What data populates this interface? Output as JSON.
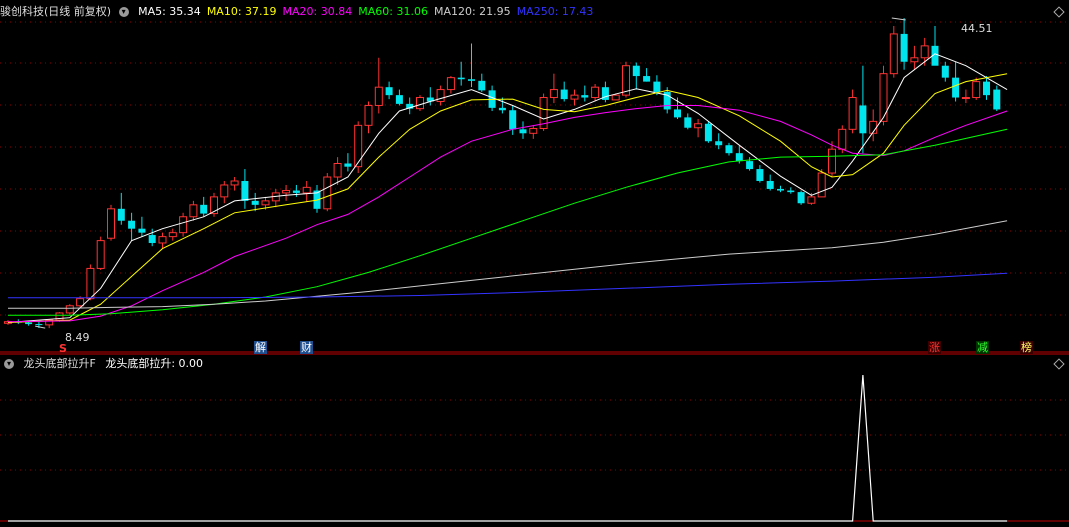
{
  "main_header": {
    "title": "骏创科技(日线 前复权)",
    "ma": [
      {
        "label": "MA5: 35.34",
        "color": "#ffffff"
      },
      {
        "label": "MA10: 37.19",
        "color": "#ffff00"
      },
      {
        "label": "MA20: 30.84",
        "color": "#ff00ff"
      },
      {
        "label": "MA60: 31.06",
        "color": "#00ff00"
      },
      {
        "label": "MA120: 21.95",
        "color": "#cccccc"
      },
      {
        "label": "MA250: 17.43",
        "color": "#3333ff"
      }
    ]
  },
  "sub_header": {
    "title": "龙头底部拉升F",
    "value_label": "龙头底部拉升: 0.00"
  },
  "price_labels": {
    "high": "44.51",
    "low": "8.49"
  },
  "event_tags": [
    {
      "text": "S",
      "color": "#ff3333",
      "bg": "transparent"
    },
    {
      "text": "解",
      "color": "#ffffff",
      "bg": "#1f4f8f"
    },
    {
      "text": "财",
      "color": "#ffffff",
      "bg": "#1f4f8f"
    },
    {
      "text": "涨",
      "color": "#ff3333",
      "bg": "#3a0000"
    },
    {
      "text": "减",
      "color": "#33ff33",
      "bg": "#003300"
    },
    {
      "text": "榜",
      "color": "#ffff66",
      "bg": "#3a0000"
    }
  ],
  "colors": {
    "up": "#ff3333",
    "down": "#00e5ee",
    "grid": "#8b0000",
    "axis": "#c00000"
  },
  "chart_data": {
    "type": "candlestick",
    "price_range": [
      7.5,
      47
    ],
    "ohlc": [
      [
        9.1,
        9.5,
        8.9,
        9.3
      ],
      [
        9.3,
        9.6,
        9.0,
        9.2
      ],
      [
        9.2,
        9.4,
        8.8,
        9.0
      ],
      [
        9.0,
        9.3,
        8.5,
        8.9
      ],
      [
        8.9,
        9.6,
        8.49,
        9.5
      ],
      [
        9.5,
        10.5,
        9.3,
        10.4
      ],
      [
        10.4,
        11.5,
        10.2,
        11.3
      ],
      [
        11.3,
        12.5,
        11.0,
        12.2
      ],
      [
        12.2,
        16.5,
        12.0,
        16.0
      ],
      [
        16.0,
        20.0,
        15.8,
        19.5
      ],
      [
        19.8,
        24.0,
        19.5,
        23.5
      ],
      [
        23.5,
        25.5,
        21.5,
        22.0
      ],
      [
        22.0,
        23.0,
        19.5,
        21.0
      ],
      [
        21.0,
        22.5,
        20.0,
        20.5
      ],
      [
        20.2,
        21.0,
        18.8,
        19.2
      ],
      [
        19.2,
        20.5,
        18.5,
        20.0
      ],
      [
        20.0,
        21.0,
        19.5,
        20.5
      ],
      [
        20.5,
        23.0,
        20.0,
        22.5
      ],
      [
        22.5,
        24.5,
        22.0,
        24.0
      ],
      [
        24.0,
        25.0,
        22.5,
        22.9
      ],
      [
        22.9,
        25.5,
        22.5,
        25.0
      ],
      [
        25.0,
        27.0,
        24.2,
        26.5
      ],
      [
        26.5,
        27.5,
        25.8,
        27.0
      ],
      [
        27.0,
        28.5,
        23.5,
        24.5
      ],
      [
        24.5,
        25.5,
        23.2,
        24.0
      ],
      [
        24.0,
        25.0,
        23.4,
        24.5
      ],
      [
        24.5,
        26.0,
        23.7,
        25.5
      ],
      [
        25.5,
        26.5,
        24.5,
        25.8
      ],
      [
        25.8,
        26.5,
        25.0,
        25.5
      ],
      [
        25.5,
        27.0,
        24.4,
        26.2
      ],
      [
        25.8,
        26.5,
        23.0,
        23.5
      ],
      [
        23.5,
        28.0,
        23.2,
        27.5
      ],
      [
        27.5,
        30.0,
        26.5,
        29.2
      ],
      [
        29.2,
        30.5,
        28.2,
        28.8
      ],
      [
        28.8,
        34.5,
        28.0,
        34.0
      ],
      [
        34.0,
        37.0,
        33.0,
        36.5
      ],
      [
        36.5,
        42.5,
        35.5,
        38.8
      ],
      [
        38.8,
        39.5,
        37.3,
        37.8
      ],
      [
        37.8,
        38.5,
        36.5,
        36.7
      ],
      [
        36.7,
        37.5,
        35.4,
        36.1
      ],
      [
        36.1,
        37.8,
        35.8,
        37.5
      ],
      [
        37.5,
        38.8,
        36.5,
        37.0
      ],
      [
        37.0,
        39.0,
        36.5,
        38.5
      ],
      [
        38.5,
        40.2,
        38.0,
        40.0
      ],
      [
        40.0,
        42.0,
        39.0,
        39.8
      ],
      [
        39.8,
        44.3,
        38.8,
        39.6
      ],
      [
        39.6,
        40.5,
        38.2,
        38.4
      ],
      [
        38.4,
        39.0,
        35.8,
        36.2
      ],
      [
        36.2,
        37.5,
        35.5,
        35.9
      ],
      [
        35.9,
        36.5,
        32.8,
        33.5
      ],
      [
        33.5,
        34.5,
        32.3,
        33.0
      ],
      [
        33.0,
        34.0,
        32.3,
        33.6
      ],
      [
        33.6,
        38.0,
        33.3,
        37.5
      ],
      [
        37.5,
        40.5,
        36.8,
        38.5
      ],
      [
        38.5,
        39.5,
        37.0,
        37.3
      ],
      [
        37.3,
        38.5,
        36.5,
        37.8
      ],
      [
        37.8,
        39.0,
        37.0,
        37.5
      ],
      [
        37.5,
        39.2,
        37.0,
        38.8
      ],
      [
        38.8,
        39.5,
        36.9,
        37.2
      ],
      [
        37.2,
        38.0,
        37.2,
        37.8
      ],
      [
        37.8,
        42.0,
        37.5,
        41.5
      ],
      [
        41.5,
        41.9,
        38.5,
        40.2
      ],
      [
        40.2,
        41.2,
        39.5,
        39.5
      ],
      [
        39.5,
        40.3,
        37.8,
        38.2
      ],
      [
        38.2,
        38.8,
        35.5,
        36.0
      ],
      [
        36.0,
        37.5,
        34.8,
        35.0
      ],
      [
        35.0,
        35.5,
        33.5,
        33.7
      ],
      [
        33.7,
        34.8,
        32.5,
        34.2
      ],
      [
        34.2,
        34.5,
        31.8,
        32.0
      ],
      [
        32.0,
        33.0,
        31.0,
        31.5
      ],
      [
        31.5,
        31.8,
        30.2,
        30.5
      ],
      [
        30.5,
        31.4,
        29.2,
        29.5
      ],
      [
        29.5,
        30.0,
        28.3,
        28.5
      ],
      [
        28.5,
        29.0,
        26.8,
        27.0
      ],
      [
        27.0,
        27.8,
        25.8,
        26.0
      ],
      [
        26.0,
        26.4,
        25.6,
        25.8
      ],
      [
        25.8,
        26.2,
        25.4,
        25.6
      ],
      [
        25.6,
        25.8,
        24.0,
        24.2
      ],
      [
        24.2,
        25.5,
        24.0,
        25.0
      ],
      [
        25.0,
        28.5,
        25.0,
        28.0
      ],
      [
        28.0,
        32.0,
        27.5,
        31.0
      ],
      [
        31.0,
        34.0,
        30.5,
        33.5
      ],
      [
        33.5,
        38.5,
        33.0,
        37.5
      ],
      [
        36.5,
        41.5,
        30.5,
        33.0
      ],
      [
        33.0,
        36.0,
        32.0,
        34.5
      ],
      [
        34.5,
        41.5,
        34.0,
        40.5
      ],
      [
        40.5,
        46.5,
        40.0,
        45.5
      ],
      [
        45.5,
        47.5,
        41.0,
        42.0
      ],
      [
        42.0,
        44.0,
        41.0,
        42.5
      ],
      [
        42.5,
        45.0,
        41.5,
        44.0
      ],
      [
        44.0,
        46.5,
        42.0,
        41.5
      ],
      [
        41.5,
        42.0,
        39.5,
        40.0
      ],
      [
        40.0,
        42.0,
        37.0,
        37.5
      ],
      [
        37.5,
        38.5,
        36.8,
        37.5
      ],
      [
        37.5,
        40.0,
        37.2,
        39.5
      ],
      [
        39.5,
        40.2,
        37.2,
        37.8
      ],
      [
        38.5,
        39.0,
        35.8,
        36.0
      ]
    ],
    "ma_lines": [
      {
        "name": "MA5",
        "color": "#ffffff",
        "points": [
          [
            0,
            9.2
          ],
          [
            6,
            9.8
          ],
          [
            9,
            13.5
          ],
          [
            12,
            19.5
          ],
          [
            15,
            21.0
          ],
          [
            19,
            22.5
          ],
          [
            22,
            24.5
          ],
          [
            27,
            25.2
          ],
          [
            30,
            25.5
          ],
          [
            33,
            27.5
          ],
          [
            36,
            33.0
          ],
          [
            38,
            35.8
          ],
          [
            41,
            37.0
          ],
          [
            45,
            38.5
          ],
          [
            49,
            36.5
          ],
          [
            52,
            34.8
          ],
          [
            55,
            36.0
          ],
          [
            58,
            37.6
          ],
          [
            61,
            38.6
          ],
          [
            64,
            37.8
          ],
          [
            67,
            35.5
          ],
          [
            71,
            31.5
          ],
          [
            75,
            27.6
          ],
          [
            78,
            25.2
          ],
          [
            80,
            26.2
          ],
          [
            82,
            29.5
          ],
          [
            85,
            35.0
          ],
          [
            87,
            40.0
          ],
          [
            90,
            43.0
          ],
          [
            93,
            41.5
          ],
          [
            97,
            38.5
          ]
        ]
      },
      {
        "name": "MA10",
        "color": "#ffff00",
        "points": [
          [
            0,
            9.2
          ],
          [
            6,
            9.5
          ],
          [
            9,
            11.5
          ],
          [
            12,
            15.0
          ],
          [
            15,
            18.5
          ],
          [
            19,
            21.0
          ],
          [
            22,
            23.0
          ],
          [
            27,
            24.0
          ],
          [
            30,
            24.6
          ],
          [
            33,
            26.0
          ],
          [
            36,
            30.0
          ],
          [
            39,
            33.5
          ],
          [
            42,
            35.8
          ],
          [
            45,
            37.2
          ],
          [
            49,
            37.3
          ],
          [
            52,
            36.0
          ],
          [
            55,
            35.7
          ],
          [
            58,
            36.5
          ],
          [
            61,
            37.5
          ],
          [
            64,
            38.4
          ],
          [
            67,
            37.5
          ],
          [
            71,
            35.2
          ],
          [
            75,
            32.0
          ],
          [
            78,
            28.8
          ],
          [
            80,
            27.5
          ],
          [
            82,
            27.8
          ],
          [
            85,
            30.5
          ],
          [
            87,
            34.0
          ],
          [
            90,
            38.0
          ],
          [
            93,
            39.5
          ],
          [
            97,
            40.5
          ]
        ]
      },
      {
        "name": "MA20",
        "color": "#ff00ff",
        "points": [
          [
            0,
            9.3
          ],
          [
            6,
            9.4
          ],
          [
            9,
            10.0
          ],
          [
            12,
            11.3
          ],
          [
            15,
            13.2
          ],
          [
            19,
            15.5
          ],
          [
            22,
            17.5
          ],
          [
            27,
            19.8
          ],
          [
            30,
            21.5
          ],
          [
            33,
            22.8
          ],
          [
            36,
            25.0
          ],
          [
            39,
            27.5
          ],
          [
            42,
            30.0
          ],
          [
            45,
            32.0
          ],
          [
            49,
            33.5
          ],
          [
            52,
            34.2
          ],
          [
            55,
            35.0
          ],
          [
            58,
            35.6
          ],
          [
            61,
            36.1
          ],
          [
            64,
            36.5
          ],
          [
            67,
            36.5
          ],
          [
            71,
            35.9
          ],
          [
            75,
            34.5
          ],
          [
            78,
            32.8
          ],
          [
            80,
            31.5
          ],
          [
            82,
            30.5
          ],
          [
            85,
            30.2
          ],
          [
            87,
            30.8
          ],
          [
            90,
            32.5
          ],
          [
            93,
            34.0
          ],
          [
            97,
            35.8
          ]
        ]
      },
      {
        "name": "MA60",
        "color": "#00ff00",
        "points": [
          [
            0,
            10.1
          ],
          [
            6,
            10.1
          ],
          [
            10,
            10.3
          ],
          [
            15,
            10.8
          ],
          [
            20,
            11.5
          ],
          [
            25,
            12.4
          ],
          [
            30,
            13.7
          ],
          [
            35,
            15.5
          ],
          [
            40,
            17.6
          ],
          [
            45,
            19.8
          ],
          [
            50,
            22.0
          ],
          [
            55,
            24.2
          ],
          [
            60,
            26.2
          ],
          [
            65,
            28.0
          ],
          [
            70,
            29.4
          ],
          [
            75,
            30.0
          ],
          [
            80,
            30.1
          ],
          [
            85,
            30.3
          ],
          [
            90,
            31.5
          ],
          [
            97,
            33.5
          ]
        ]
      },
      {
        "name": "MA120",
        "color": "#cccccc",
        "points": [
          [
            0,
            11.0
          ],
          [
            6,
            11.0
          ],
          [
            10,
            11.1
          ],
          [
            15,
            11.2
          ],
          [
            20,
            11.5
          ],
          [
            25,
            11.9
          ],
          [
            30,
            12.5
          ],
          [
            35,
            13.1
          ],
          [
            40,
            13.8
          ],
          [
            45,
            14.5
          ],
          [
            50,
            15.2
          ],
          [
            55,
            15.9
          ],
          [
            60,
            16.6
          ],
          [
            65,
            17.2
          ],
          [
            70,
            17.8
          ],
          [
            75,
            18.2
          ],
          [
            80,
            18.6
          ],
          [
            85,
            19.3
          ],
          [
            90,
            20.3
          ],
          [
            97,
            22.0
          ]
        ]
      },
      {
        "name": "MA250",
        "color": "#3333ff",
        "points": [
          [
            0,
            12.3
          ],
          [
            10,
            12.3
          ],
          [
            20,
            12.3
          ],
          [
            30,
            12.4
          ],
          [
            40,
            12.6
          ],
          [
            50,
            13.0
          ],
          [
            60,
            13.5
          ],
          [
            70,
            14.0
          ],
          [
            80,
            14.4
          ],
          [
            90,
            14.9
          ],
          [
            97,
            15.4
          ]
        ]
      }
    ],
    "indicator": {
      "name": "龙头底部拉升",
      "color": "#ffffff",
      "range": [
        0,
        1
      ],
      "values_at": [
        [
          0,
          0
        ],
        [
          82,
          0
        ],
        [
          83,
          1
        ],
        [
          84,
          0
        ],
        [
          97,
          0
        ]
      ]
    }
  }
}
